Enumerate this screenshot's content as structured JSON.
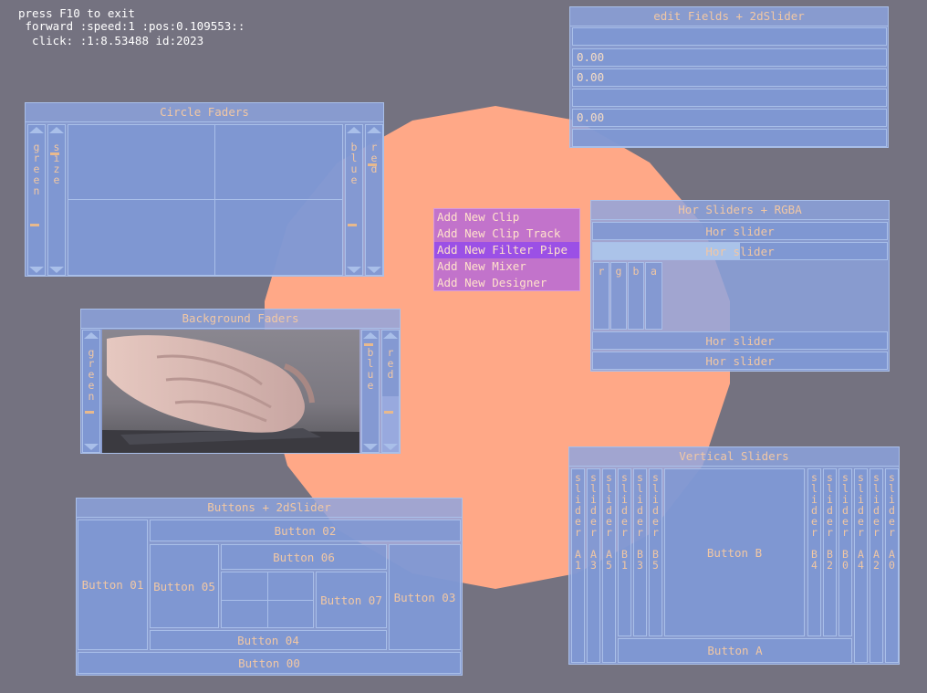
{
  "status": {
    "line1": "press F10 to exit",
    "line2": " forward :speed:1 :pos:0.109553::",
    "line3": "  click: :1:8.53488 id:2023"
  },
  "colors": {
    "background": "#747280",
    "circle": "#ffa887",
    "panel": "#8ca5e1",
    "accent_text": "#f1c7a4",
    "menu": "#c273cb",
    "menu_highlight": "#9b50e6"
  },
  "edit_fields": {
    "title": "edit Fields + 2dSlider",
    "fields": [
      "",
      "0.00",
      "0.00",
      "",
      "0.00",
      ""
    ]
  },
  "circle_faders": {
    "title": "Circle Faders",
    "left_sliders": [
      "green",
      "size"
    ],
    "right_sliders": [
      "blue",
      "red"
    ]
  },
  "background_faders": {
    "title": "Background Faders",
    "left_sliders": [
      "green"
    ],
    "right_sliders": [
      "blue",
      "red"
    ]
  },
  "context_menu": {
    "items": [
      "Add New Clip",
      "Add New Clip Track",
      "Add New Filter Pipe",
      "Add New Mixer",
      "Add New Designer"
    ],
    "highlighted": "Add New Filter Pipe"
  },
  "hor_sliders": {
    "title": "Hor Sliders + RGBA",
    "sliders": [
      "Hor slider",
      "Hor slider",
      "Hor slider",
      "Hor slider"
    ],
    "second_slider_fill": 0.5,
    "rgba": [
      "r",
      "g",
      "b",
      "a"
    ]
  },
  "buttons_panel": {
    "title": "Buttons + 2dSlider",
    "button00": "Button 00",
    "button01": "Button 01",
    "button02": "Button 02",
    "button03": "Button 03",
    "button04": "Button 04",
    "button05": "Button 05",
    "button06": "Button 06",
    "button07": "Button 07"
  },
  "vertical_sliders": {
    "title": "Vertical Sliders",
    "left": [
      "slider A1",
      "slider A3",
      "slider A5",
      "slider B1",
      "slider B3",
      "slider B5"
    ],
    "right": [
      "slider B4",
      "slider B2",
      "slider B0",
      "slider A4",
      "slider A2",
      "slider A0"
    ],
    "button_b": "Button B",
    "button_a": "Button A"
  }
}
